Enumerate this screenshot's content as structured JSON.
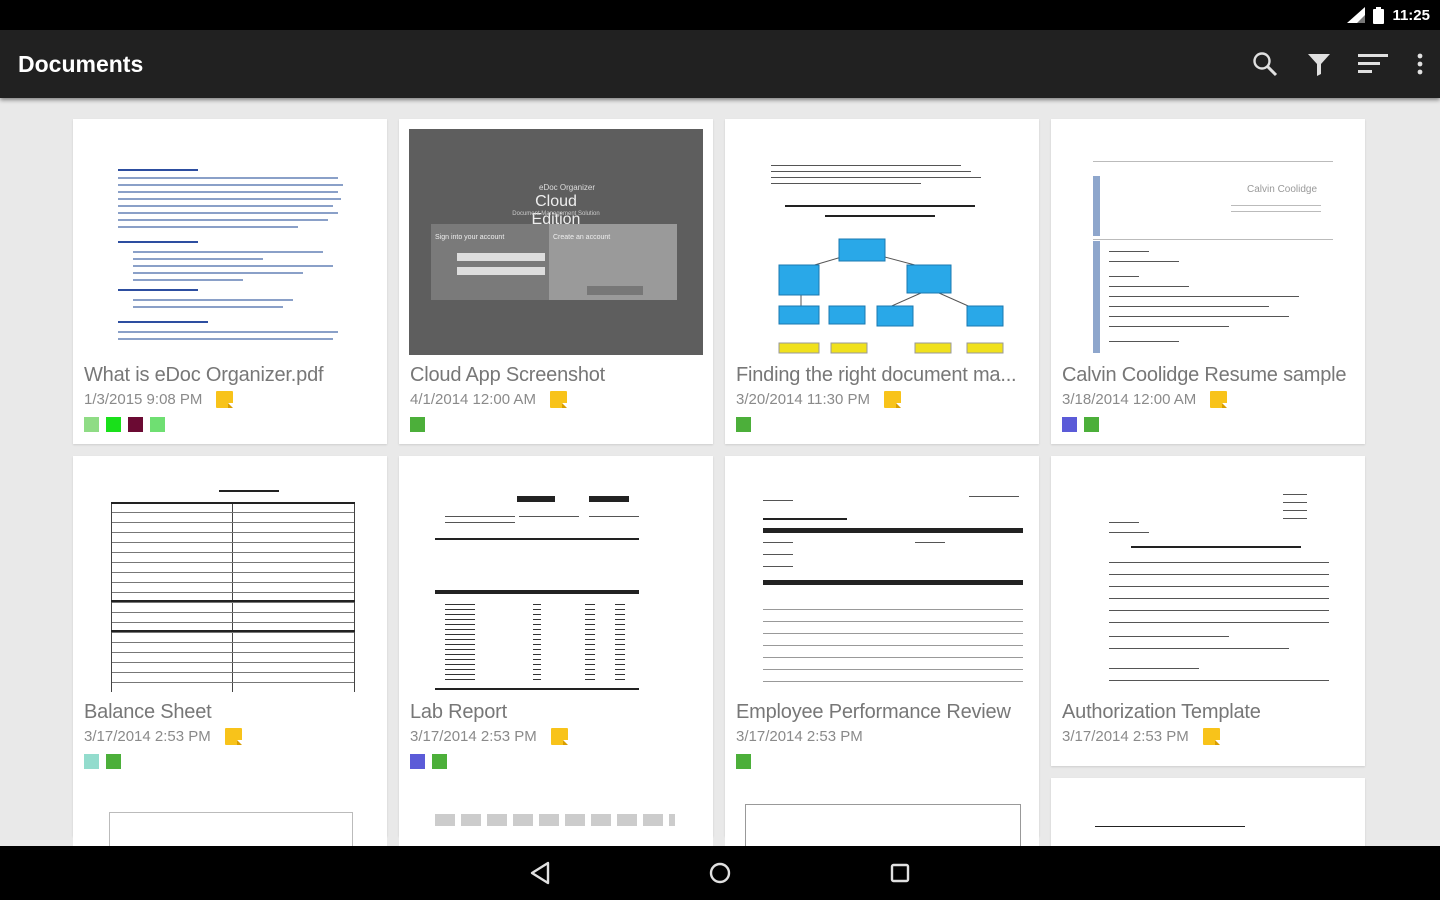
{
  "status_bar": {
    "time": "11:25"
  },
  "app_bar": {
    "title": "Documents",
    "actions": [
      "search-icon",
      "filter-icon",
      "sort-icon",
      "overflow-menu-icon"
    ]
  },
  "documents": [
    {
      "name": "What is eDoc Organizer.pdf",
      "date": "1/3/2015 9:08 PM",
      "has_note": true,
      "tags": [
        "#8fdc85",
        "#19e01a",
        "#6b0a33",
        "#6fdf72"
      ]
    },
    {
      "name": "Cloud App Screenshot",
      "date": "4/1/2014 12:00 AM",
      "has_note": true,
      "tags": [
        "#4caf3a"
      ],
      "thumb_text": {
        "brand": "eDoc Organizer",
        "edition": "Cloud Edition",
        "subtitle": "Document Management Solution",
        "signin": "Sign into your account",
        "create": "Create an account"
      }
    },
    {
      "name": "Finding the right document ma...",
      "date": "3/20/2014 11:30 PM",
      "has_note": true,
      "tags": [
        "#4caf3a"
      ]
    },
    {
      "name": "Calvin Coolidge Resume sample",
      "date": "3/18/2014 12:00 AM",
      "has_note": true,
      "tags": [
        "#5b5bd8",
        "#4caf3a"
      ],
      "thumb_text": {
        "header": "Calvin Coolidge"
      }
    },
    {
      "name": "Balance Sheet",
      "date": "3/17/2014 2:53 PM",
      "has_note": true,
      "tags": [
        "#93dccd",
        "#4caf3a"
      ]
    },
    {
      "name": "Lab Report",
      "date": "3/17/2014 2:53 PM",
      "has_note": true,
      "tags": [
        "#5b5bd8",
        "#4caf3a"
      ]
    },
    {
      "name": "Employee Performance Review",
      "date": "3/17/2014 2:53 PM",
      "has_note": false,
      "tags": [
        "#4caf3a"
      ]
    },
    {
      "name": "Authorization Template",
      "date": "3/17/2014 2:53 PM",
      "has_note": true,
      "tags": []
    }
  ],
  "colors": {
    "note": "#f8c31a",
    "app_bar": "#212121",
    "background": "#e9e9e9"
  },
  "nav_bar": [
    "back-icon",
    "home-icon",
    "recents-icon"
  ]
}
